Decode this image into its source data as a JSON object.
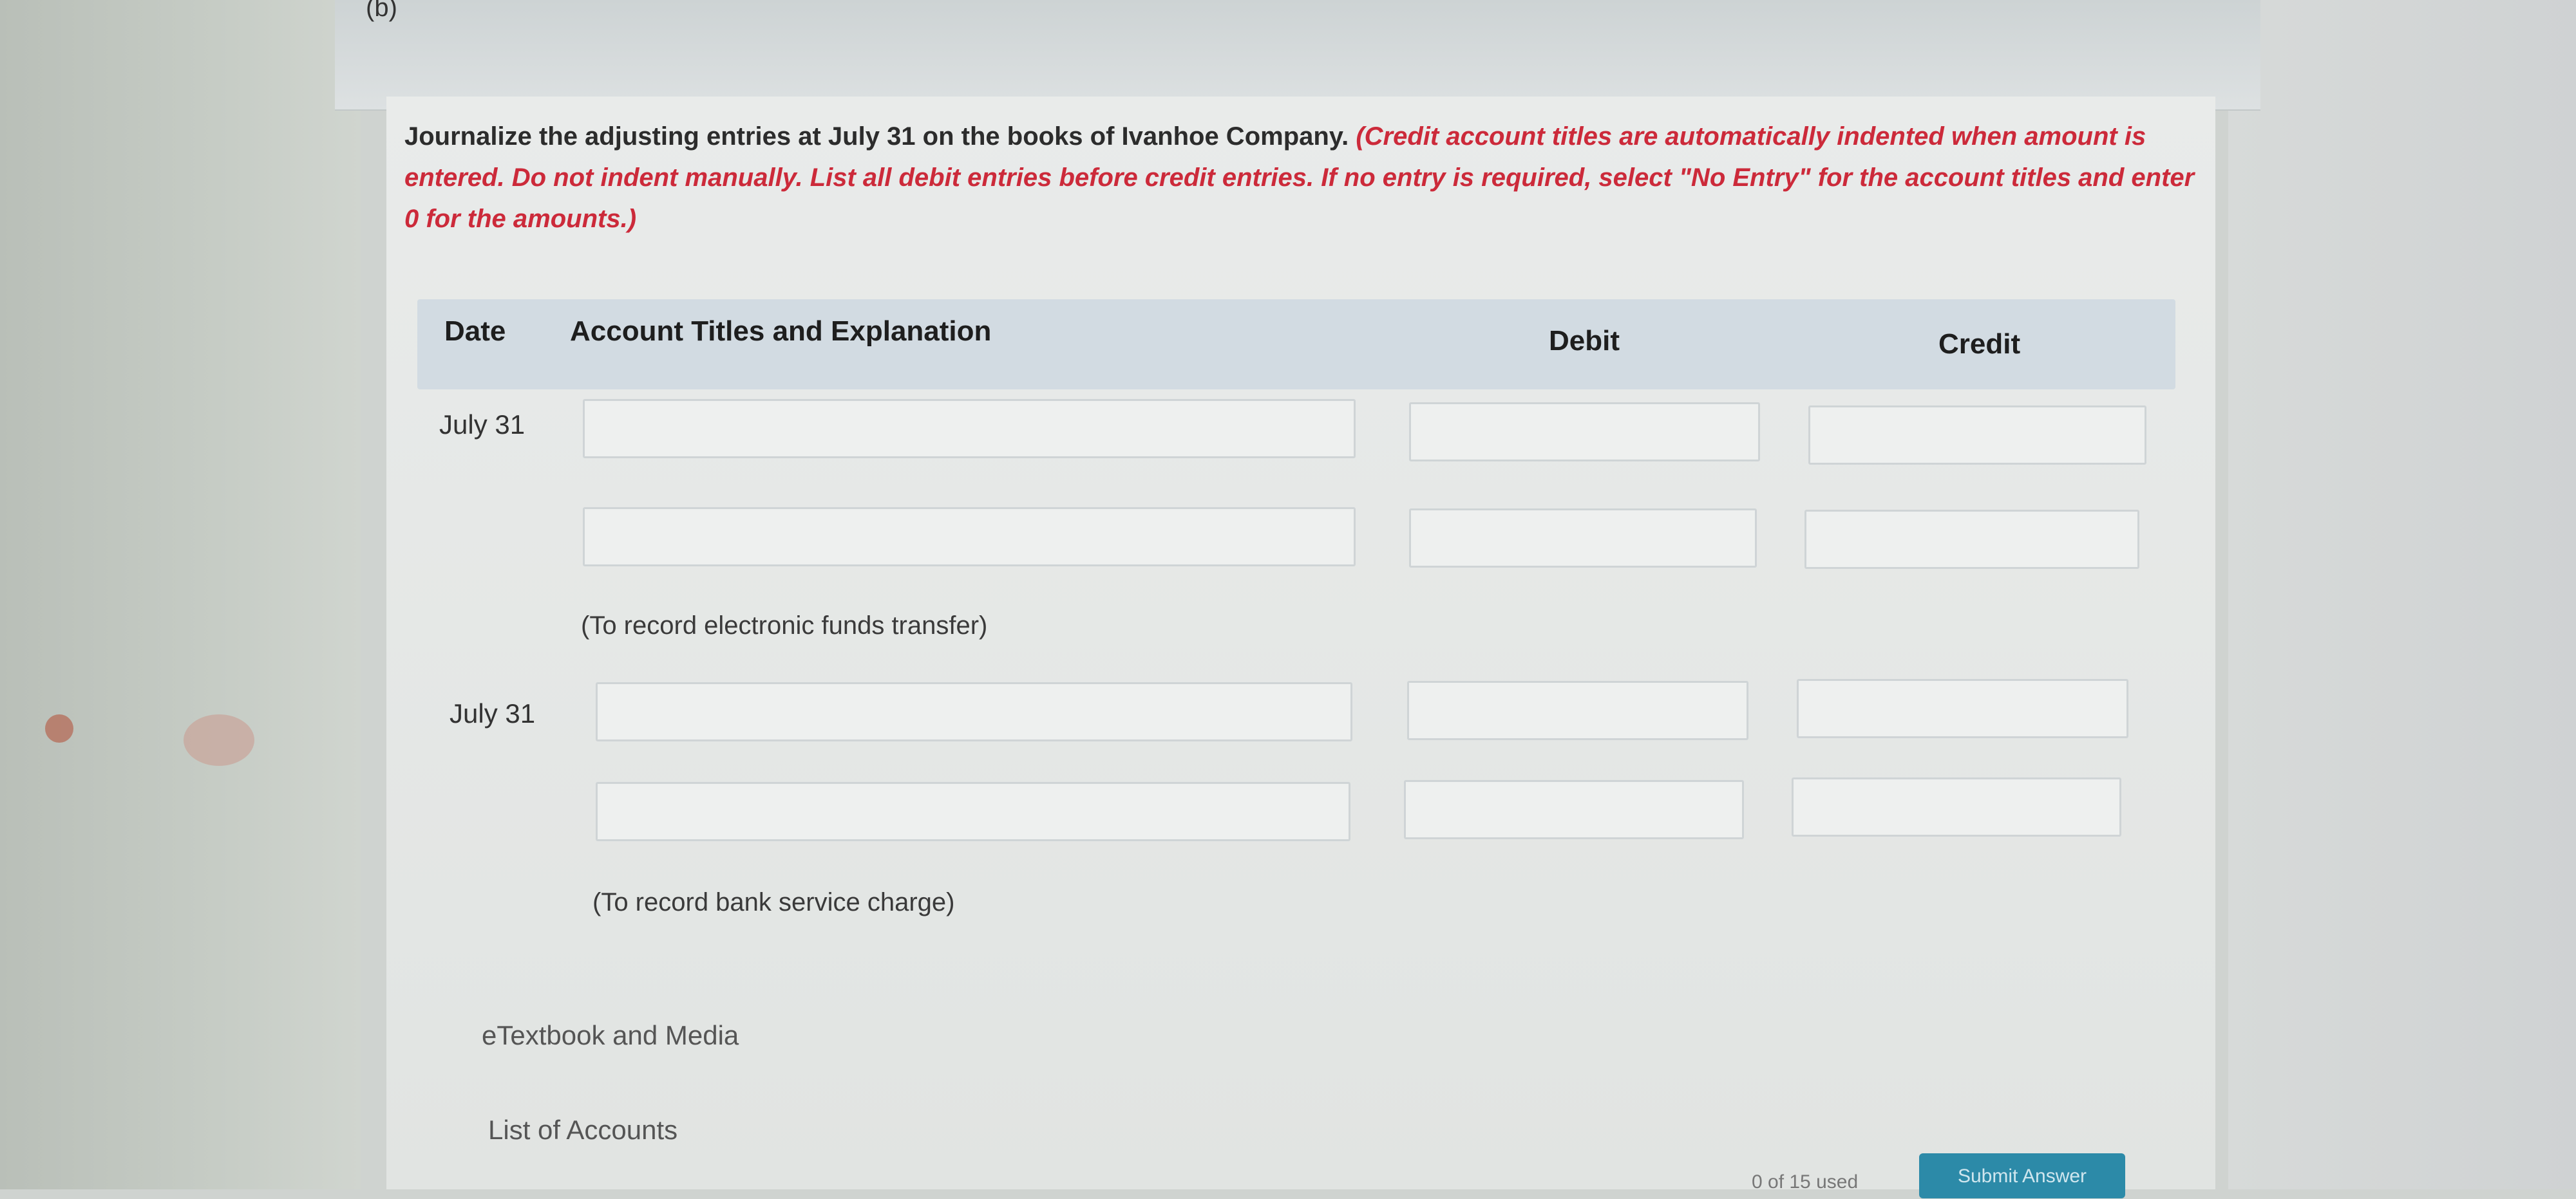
{
  "part_label": "(b)",
  "instructions": {
    "plain": "Journalize the adjusting entries at July 31 on the books of Ivanhoe Company. ",
    "emphasis": "(Credit account titles are automatically indented when amount is entered. Do not indent manually. List all debit entries before credit entries. If no entry is required, select \"No Entry\" for the account titles and enter 0 for the amounts.)"
  },
  "table": {
    "headers": {
      "date": "Date",
      "account": "Account Titles and Explanation",
      "debit": "Debit",
      "credit": "Credit"
    },
    "entries": [
      {
        "date": "July 31",
        "rows": [
          {
            "account": "",
            "debit": "",
            "credit": ""
          },
          {
            "account": "",
            "debit": "",
            "credit": ""
          }
        ],
        "explanation": "(To record electronic funds transfer)"
      },
      {
        "date": "July 31",
        "rows": [
          {
            "account": "",
            "debit": "",
            "credit": ""
          },
          {
            "account": "",
            "debit": "",
            "credit": ""
          }
        ],
        "explanation": "(To record bank service charge)"
      }
    ]
  },
  "links": {
    "etextbook": "eTextbook and Media",
    "list_of_accounts": "List of Accounts"
  },
  "footer": {
    "attempts": "0 of 15 used",
    "submit": "Submit Answer"
  },
  "colors": {
    "emphasis_red": "#cc2a3a",
    "header_bg": "#d2dbe2",
    "submit_bg": "#2c8aa8"
  }
}
